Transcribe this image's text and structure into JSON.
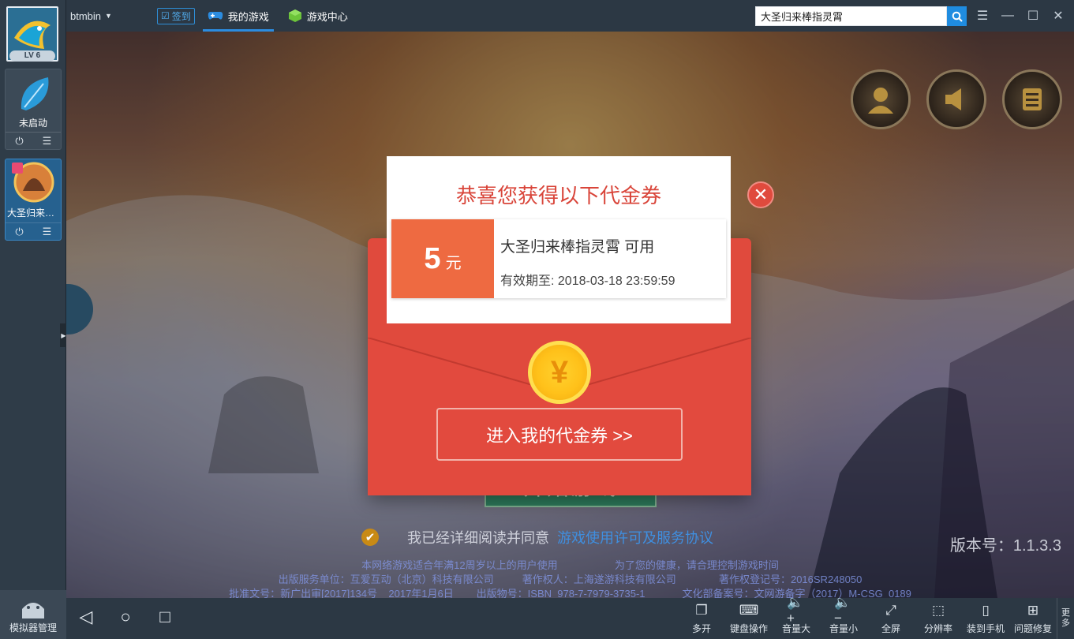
{
  "topbar": {
    "username": "btmbin",
    "signin_label": "签到",
    "tabs": [
      {
        "label": "我的游戏",
        "active": true
      },
      {
        "label": "游戏中心",
        "active": false
      }
    ],
    "search_value": "大圣归来棒指灵霄"
  },
  "sidebar": {
    "level": "LV 6",
    "idle_app_label": "未启动",
    "game_label": "大圣归来棒...",
    "sim_manager_label": "模拟器管理"
  },
  "game": {
    "start_label": "开始游戏",
    "agree_text": "我已经详细阅读并同意",
    "agree_link": "游戏使用许可及服务协议",
    "version": "版本号：1.1.3.3",
    "legal_lines": [
      "本网络游戏适合年满12周岁以上的用户使用                    为了您的健康，请合理控制游戏时间",
      "出版服务单位：互爱互动（北京）科技有限公司          著作权人：上海遂游科技有限公司               著作权登记号：2016SR248050",
      "批准文号：新广出审[2017]134号    2017年1月6日        出版物号：ISBN  978-7-7979-3735-1             文化部备案号：文网游备字（2017）M-CSG  0189"
    ]
  },
  "modal": {
    "title": "恭喜您获得以下代金券",
    "amount": "5",
    "unit": "元",
    "coupon_name": "大圣归来棒指灵霄 可用",
    "validity": "有效期至: 2018-03-18 23:59:59",
    "coin_symbol": "¥",
    "enter_label": "进入我的代金券 >>"
  },
  "bottombar": {
    "tools": [
      {
        "label": "多开",
        "icon": "multi-window-icon"
      },
      {
        "label": "键盘操作",
        "icon": "keyboard-icon"
      },
      {
        "label": "音量大",
        "icon": "volume-up-icon"
      },
      {
        "label": "音量小",
        "icon": "volume-down-icon"
      },
      {
        "label": "全屏",
        "icon": "fullscreen-icon"
      },
      {
        "label": "分辨率",
        "icon": "resolution-icon"
      },
      {
        "label": "装到手机",
        "icon": "phone-icon"
      },
      {
        "label": "问题修复",
        "icon": "repair-icon"
      }
    ],
    "more_label": "更多"
  }
}
